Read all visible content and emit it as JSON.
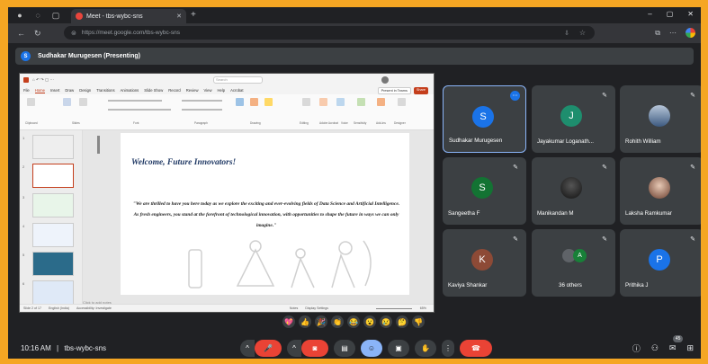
{
  "browser": {
    "tab_title": "Meet - tbs-wybc-sns",
    "url": "https://meet.google.com/tbs-wybc-sns",
    "new_tab": "+",
    "window_controls": [
      "–",
      "▢",
      "✕"
    ]
  },
  "banner": {
    "initial": "S",
    "text": "Sudhakar Murugesen (Presenting)"
  },
  "powerpoint": {
    "search_placeholder": "Search",
    "menu": [
      "File",
      "Home",
      "Insert",
      "Draw",
      "Design",
      "Transitions",
      "Animations",
      "Slide Show",
      "Record",
      "Review",
      "View",
      "Help",
      "Acrobat"
    ],
    "present_teams": "Present in Teams",
    "share": "Share",
    "ribbon_groups": [
      "Clipboard",
      "Slides",
      "Font",
      "Paragraph",
      "Drawing",
      "Editing",
      "Adobe Acrobat",
      "Voice",
      "Sensitivity",
      "Add-ins",
      "Designer"
    ],
    "slide_numbers": [
      "1",
      "2",
      "3",
      "4",
      "5",
      "6"
    ],
    "notes_placeholder": "Click to add notes",
    "status_left": "Slide 2 of 17",
    "status_lang": "English (India)",
    "status_access": "Accessibility: Investigate",
    "status_notes": "Notes",
    "status_display": "Display Settings",
    "zoom": "65%"
  },
  "slide": {
    "title": "Welcome, Future Innovators!",
    "quote": "\"We are thrilled to have you here today as we explore the exciting and ever-evolving fields of Data Science and Artificial Intelligence. As fresh engineers, you stand at the forefront of technological innovation, with opportunities to shape the future in ways we can only imagine.\""
  },
  "participants": [
    {
      "name": "Sudhakar Murugesen",
      "initial": "S",
      "color": "#1a73e8",
      "active": true
    },
    {
      "name": "Jayakumar Loganath...",
      "initial": "J",
      "color": "#1e8e6e",
      "active": false
    },
    {
      "name": "Rohith William",
      "initial": "",
      "color": "#5b7a99",
      "active": false
    },
    {
      "name": "Sangeetha F",
      "initial": "S",
      "color": "#137333",
      "active": false
    },
    {
      "name": "Manikandan M",
      "initial": "",
      "color": "#222222",
      "active": false
    },
    {
      "name": "Laksha Ramkumar",
      "initial": "",
      "color": "#c9a78c",
      "active": false
    },
    {
      "name": "Kaviya Shankar",
      "initial": "K",
      "color": "#8d4a36",
      "active": false
    },
    {
      "name": "36 others",
      "initial": "A",
      "color": "#188038",
      "active": false
    },
    {
      "name": "Prithika J",
      "initial": "P",
      "color": "#1a73e8",
      "active": false
    }
  ],
  "reactions": [
    "💖",
    "👍",
    "🎉",
    "👏",
    "😂",
    "😮",
    "😢",
    "🤔",
    "👎"
  ],
  "bottom": {
    "time": "10:16 AM",
    "separator": "|",
    "meeting_code": "tbs-wybc-sns",
    "people_count": "45"
  },
  "colors": {
    "outer_border": "#f5a623",
    "meet_bg": "#202124",
    "tile_bg": "#3c4043",
    "end_call": "#ea4335",
    "accent_blue": "#8ab4f8",
    "ppt_accent": "#c43e1c"
  }
}
